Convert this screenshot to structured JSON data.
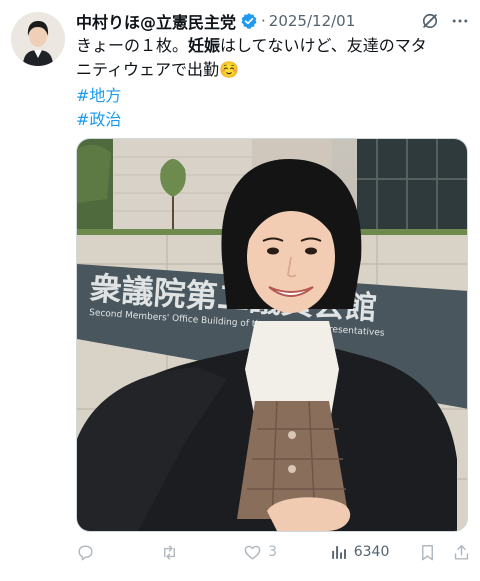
{
  "author": {
    "display_name": "中村りほ@立憲民主党",
    "timestamp": "2025/12/01"
  },
  "post": {
    "line1_a": "きょーの１枚。",
    "line1_b": "妊娠",
    "line1_c": "はしてないけど、友達のマタ",
    "line2": "ニティウェアで出勤☺️",
    "hashtags": [
      "#地方",
      "#政治"
    ]
  },
  "media": {
    "sign_kanji": "衆議院第二議員会館",
    "sign_english": "Second Members' Office Building of the House of Representatives"
  },
  "actions": {
    "reply_count": "",
    "repost_count": "",
    "like_count": "3",
    "views_count": "6340"
  },
  "colors": {
    "accent": "#1d9bf0",
    "text": "#0f1419",
    "muted": "#536471",
    "verified": "#1d9bf0"
  }
}
